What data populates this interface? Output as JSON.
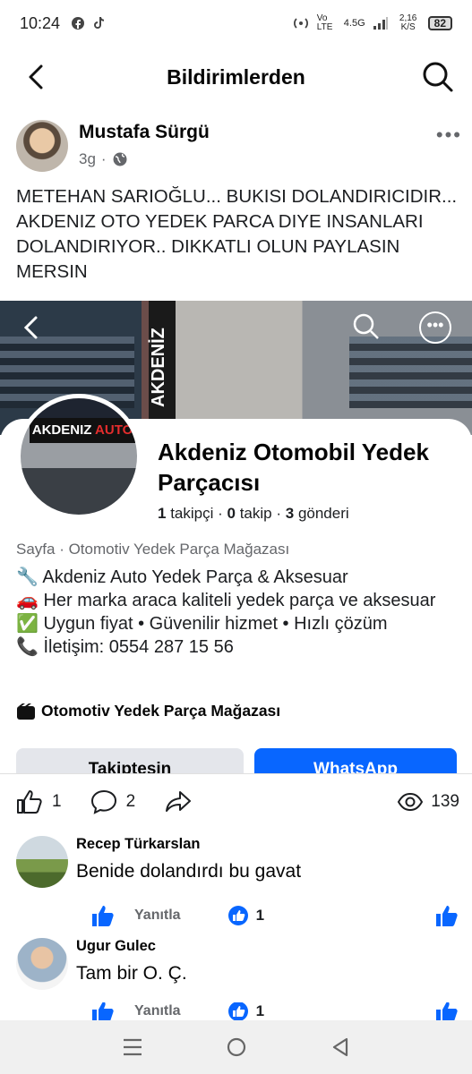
{
  "status_bar": {
    "time": "10:24",
    "network": "Vo LTE",
    "signal": "4.5G",
    "speed": "2,16 K/S",
    "battery": "82"
  },
  "header": {
    "title": "Bildirimlerden"
  },
  "post": {
    "author": "Mustafa Sürgü",
    "time": "3g",
    "text": "METEHAN SARIOĞLU... BUKISI DOLANDIRICIDIR... AKDENIZ OTO YEDEK PARCA DIYE INSANLARI DOLANDIRIYOR.. DIKKATLI OLUN PAYLASIN MERSIN"
  },
  "preview": {
    "cover_banner": "AKDENİZ",
    "avatar_logo_a": "AKDENIZ",
    "avatar_logo_b": "AUTO",
    "page_name": "Akdeniz Otomobil Yedek Parçacısı",
    "followers_count": "1",
    "followers_label": "takipçi",
    "following_count": "0",
    "following_label": "takip",
    "posts_count": "3",
    "posts_label": "gönderi",
    "category_line": "Sayfa · Otomotiv Yedek Parça Mağazası",
    "bio": [
      "🔧 Akdeniz Auto Yedek Parça & Aksesuar",
      "🚗 Her marka araca kaliteli yedek parça ve aksesuar",
      "✅ Uygun fiyat • Güvenilir hizmet • Hızlı çözüm",
      "📞 İletişim: 0554 287 15 56"
    ],
    "page_category": "Otomotiv Yedek Parça Mağazası",
    "follow_button": "Takiptesin",
    "whatsapp_button": "WhatsApp"
  },
  "reactions": {
    "likes": "1",
    "comments": "2",
    "views": "139"
  },
  "comments": [
    {
      "name": "Recep Türkarslan",
      "text": "Benide dolandırdı bu gavat",
      "reply": "Yanıtla",
      "likes": "1"
    },
    {
      "name": "Ugur Gulec",
      "text": "Tam bir O. Ç.",
      "reply": "Yanıtla",
      "likes": "1"
    }
  ],
  "colors": {
    "accent": "#0866ff",
    "muted": "#65676b"
  }
}
